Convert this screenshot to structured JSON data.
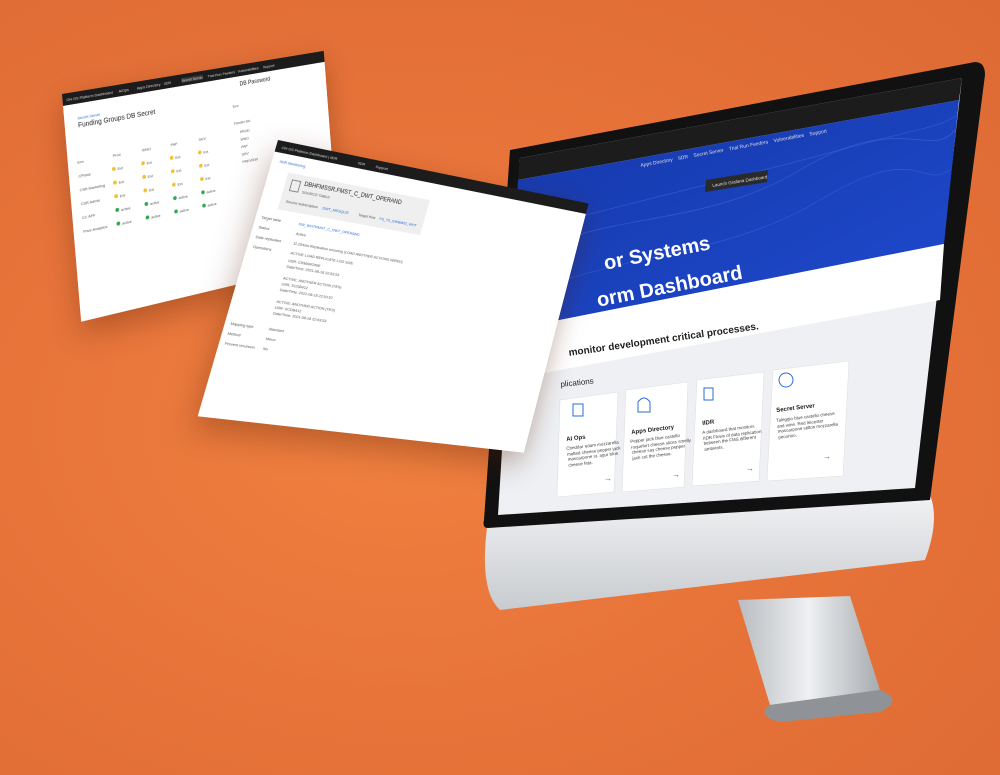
{
  "monitor": {
    "nav": {
      "items": [
        "Apps Directory",
        "IIDR",
        "Secret Server",
        "Trial Run Feeders",
        "Vulnerabilities",
        "Support"
      ],
      "dropdown_item": "Launch Grafana Dashboard"
    },
    "hero": {
      "line1": "or Systems",
      "line2": "orm Dashboard"
    },
    "tagline": "monitor development critical processes.",
    "section_title": "plications",
    "cards": [
      {
        "title": "AI Ops",
        "body": [
          "Cheddar edam mozzarella",
          "melted cheese pepper jack",
          "mascarpone st. agur blue",
          "cheese feta."
        ],
        "icon": "ai-ops-icon"
      },
      {
        "title": "Apps Directory",
        "body": [
          "Pepper jack blue castello",
          "roquefort cheese slices smelly",
          "cheese say cheese pepper",
          "jack cut the cheese."
        ],
        "icon": "cupcake-icon"
      },
      {
        "title": "IIDR",
        "body": [
          "A dashboard that monitors",
          "IIDR Flows of data replication",
          "between the FMS different",
          "ambients."
        ],
        "icon": "document-copy-icon"
      },
      {
        "title": "Secret Server",
        "body": [
          "Taleggio blue castello cheese",
          "and wine. Red leicester",
          "mascarpone stilton mozzarella",
          "pecorino."
        ],
        "icon": "badge-flower-icon"
      }
    ],
    "arrow_glyph": "→"
  },
  "panel_left": {
    "brand": "OH GS Platform Dashboard",
    "nav": [
      "AIOps",
      "Apps Directory",
      "IIDR",
      "Secret Server",
      "Trial Run Feeders",
      "Vulnerabilities",
      "Support"
    ],
    "breadcrumb": "Secret Server",
    "title": "Funding Groups DB Secret",
    "side_title": "DB Password",
    "columns": [
      "Env",
      "Prod",
      "WNO",
      "PAP",
      "DEV"
    ],
    "rows": [
      {
        "name": "CPlane",
        "cells": [
          "Ext",
          "Ext",
          "Ext",
          "Ext"
        ]
      },
      {
        "name": "CSR Marketing",
        "cells": [
          "Ext",
          "Ext",
          "Ext",
          "Ext"
        ]
      },
      {
        "name": "CSR Admin",
        "cells": [
          "Ext",
          "Ext",
          "Ext",
          "Ext"
        ]
      },
      {
        "name": "CC APF",
        "cells": [
          "active",
          "active",
          "active",
          "active"
        ]
      },
      {
        "name": "Price Analytics",
        "cells": [
          "active",
          "active",
          "active",
          "active"
        ]
      }
    ],
    "side_labels": [
      "Env",
      "Feeder list",
      "PROD",
      "WNO",
      "PAP",
      "DEV",
      "PREVIEW"
    ]
  },
  "panel_middle": {
    "brand": "OH GS Platform Dashboard | IIDR",
    "nav": [
      "IIDR",
      "Support"
    ],
    "breadcrumb": "IIDR Monitoring",
    "record_title": "DBHFMSSR.FMST_C_DWT_OPERAND",
    "record_subtitle": "SOURCE TABLE",
    "subscription_label": "Source subscription",
    "subscription_value": "DWT_MSSQLIE",
    "target_label": "Target flow",
    "target_value": "FS_TS_DWBM02_WHT",
    "fields": [
      {
        "label": "Target table",
        "value": "KW_WHTRMST_C_DWT_OPERAND"
      },
      {
        "label": "Status",
        "value": "Active"
      },
      {
        "label": "Date replicated",
        "value": "11,254ms Replication ensuring (LOAD ANOTHER ACTIONS WIRED)"
      },
      {
        "label": "Operations",
        "value": "ACTIVE LOAD REPLICATE LOG SIZE"
      },
      {
        "label": "Mapping type",
        "value": "Standard"
      },
      {
        "label": "Method",
        "value": "Mirror"
      },
      {
        "label": "Prevent recursion",
        "value": "No"
      }
    ],
    "history": [
      "USR: CRMARONIE",
      "Date/Time: 2021-08-18 22:53:53",
      "ACTIVE: ANOTHER ACTION (YES)",
      "USR: SCDB412",
      "Date/Time: 2021-08-18 22:53:57",
      "ACTIVE: ANOTHER ACTION (YES)",
      "USR: SCDB412",
      "Date/Time: 2021-08-18 22:53:53"
    ]
  },
  "colors": {
    "background": "#e8743a",
    "hero_blue": "#1a3fb8",
    "nav_dark": "#1c1c1c",
    "accent_link": "#2b6cd6",
    "status_green": "#2fa84f",
    "status_yellow": "#f2c12e"
  }
}
